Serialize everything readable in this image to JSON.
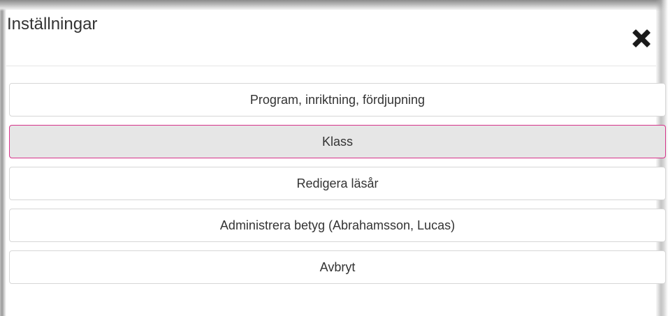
{
  "dialog": {
    "title": "Inställningar",
    "close_icon": "close-icon",
    "accent_color": "#d6338a"
  },
  "menu": {
    "items": [
      {
        "label": "Program, inriktning, fördjupning",
        "active": false
      },
      {
        "label": "Klass",
        "active": true
      },
      {
        "label": "Redigera läsår",
        "active": false
      },
      {
        "label": "Administrera betyg (Abrahamsson, Lucas)",
        "active": false
      },
      {
        "label": "Avbryt",
        "active": false
      }
    ]
  }
}
